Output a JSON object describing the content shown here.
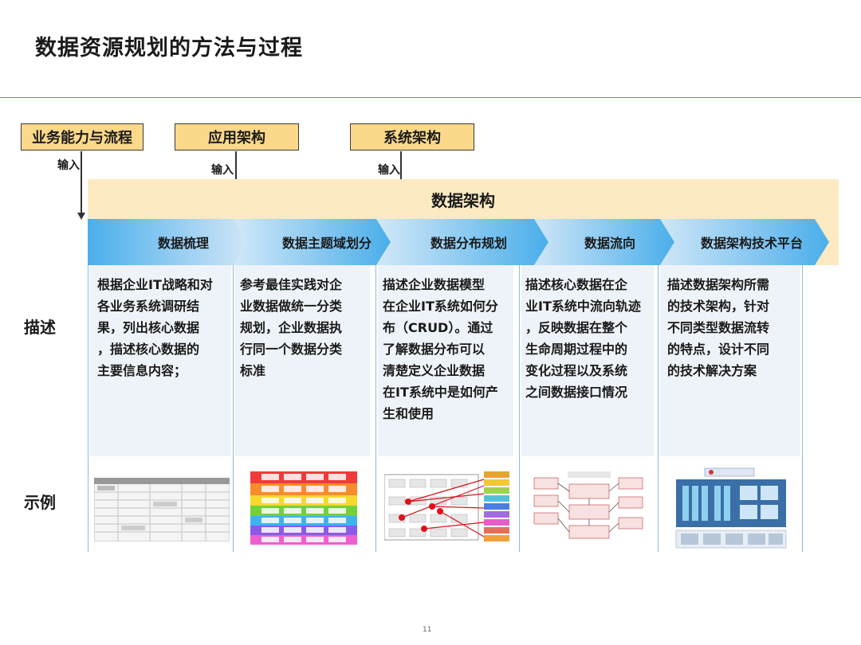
{
  "title": "数据资源规划的方法与过程",
  "inputs": [
    {
      "label": "业务能力与流程",
      "arrow_label": "输入"
    },
    {
      "label": "应用架构",
      "arrow_label": "输入"
    },
    {
      "label": "系统架构",
      "arrow_label": "输入"
    }
  ],
  "band_title": "数据架构",
  "steps": [
    {
      "label": "数据梳理"
    },
    {
      "label": "数据主题域划分"
    },
    {
      "label": "数据分布规划"
    },
    {
      "label": "数据流向"
    },
    {
      "label": "数据架构技术平台"
    }
  ],
  "row_labels": {
    "desc": "描述",
    "example": "示例"
  },
  "descriptions": [
    [
      "根据企业IT战略和对",
      "各业务系统调研结",
      "果，列出核心数据",
      "，描述核心数据的",
      "主要信息内容；"
    ],
    [
      "参考最佳实践对企",
      "业数据做统一分类",
      "规划，企业数据执",
      "行同一个数据分类",
      "标准"
    ],
    [
      "描述企业数据模型",
      "在企业IT系统如何分",
      "布（CRUD）。通过",
      "了解数据分布可以",
      "清楚定义企业数据",
      "在IT系统中是如何产",
      "生和使用"
    ],
    [
      "描述核心数据在企",
      "业IT系统中流向轨迹",
      "，反映数据在整个",
      "生命周期过程中的",
      "变化过程以及系统",
      "之间数据接口情况"
    ],
    [
      "描述数据架构所需",
      "的技术架构，针对",
      "不同类型数据流转",
      "的特点，设计不同",
      "的技术解决方案"
    ]
  ],
  "example_icons": [
    "table-thumbnail-icon",
    "color-grid-thumbnail-icon",
    "crud-network-thumbnail-icon",
    "flow-chart-thumbnail-icon",
    "platform-architecture-thumbnail-icon"
  ],
  "page_number": "11",
  "colors": {
    "accent_line": "#e8602c",
    "input_box": "#fcd98a",
    "band": "#fdeac2",
    "chevron_light": "#cfe6f8",
    "chevron_dark": "#4aaeea"
  }
}
